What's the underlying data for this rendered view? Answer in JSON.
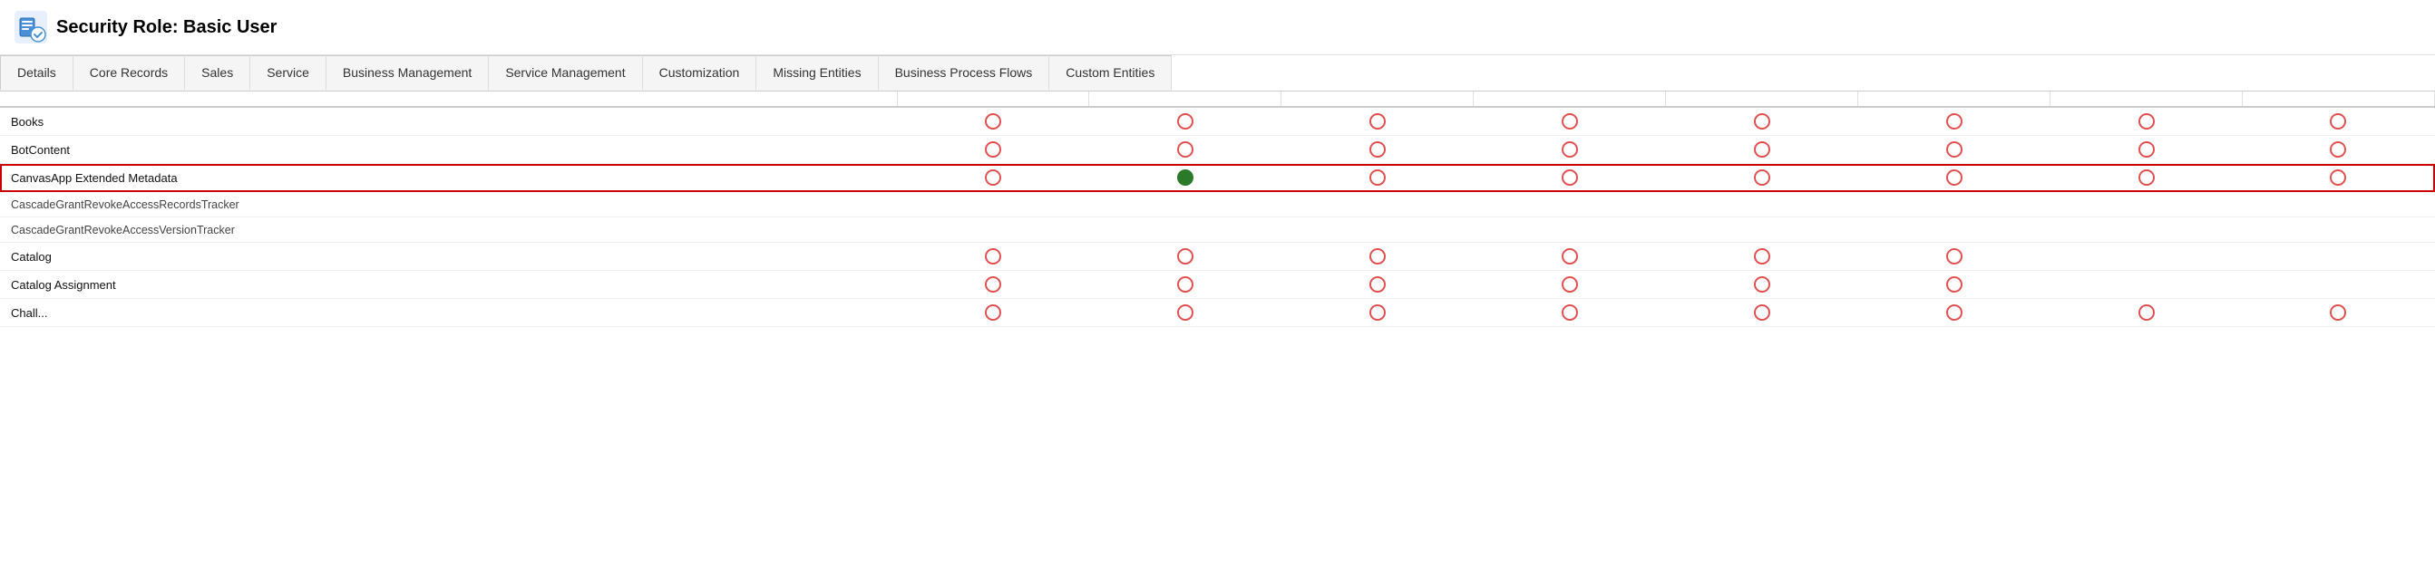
{
  "header": {
    "icon_label": "security-role-icon",
    "title": "Security Role: Basic User"
  },
  "tabs": [
    {
      "label": "Details",
      "id": "tab-details"
    },
    {
      "label": "Core Records",
      "id": "tab-core-records"
    },
    {
      "label": "Sales",
      "id": "tab-sales"
    },
    {
      "label": "Service",
      "id": "tab-service"
    },
    {
      "label": "Business Management",
      "id": "tab-business-management"
    },
    {
      "label": "Service Management",
      "id": "tab-service-management"
    },
    {
      "label": "Customization",
      "id": "tab-customization"
    },
    {
      "label": "Missing Entities",
      "id": "tab-missing-entities"
    },
    {
      "label": "Business Process Flows",
      "id": "tab-business-process-flows"
    },
    {
      "label": "Custom Entities",
      "id": "tab-custom-entities"
    }
  ],
  "table": {
    "columns": [
      {
        "label": "",
        "id": "col-entity"
      },
      {
        "label": "",
        "id": "col-1"
      },
      {
        "label": "",
        "id": "col-2"
      },
      {
        "label": "",
        "id": "col-3"
      },
      {
        "label": "",
        "id": "col-4"
      },
      {
        "label": "",
        "id": "col-5"
      },
      {
        "label": "",
        "id": "col-6"
      },
      {
        "label": "",
        "id": "col-7"
      },
      {
        "label": "",
        "id": "col-8"
      }
    ],
    "rows": [
      {
        "name": "Books",
        "highlighted": false,
        "cells": [
          "empty",
          "empty",
          "empty",
          "empty",
          "empty",
          "empty",
          "empty",
          "empty"
        ]
      },
      {
        "name": "BotContent",
        "highlighted": false,
        "cells": [
          "empty",
          "empty",
          "empty",
          "empty",
          "empty",
          "empty",
          "empty",
          "empty"
        ]
      },
      {
        "name": "CanvasApp Extended Metadata",
        "highlighted": true,
        "cells": [
          "empty",
          "filled",
          "empty",
          "empty",
          "empty",
          "empty",
          "empty",
          "empty"
        ]
      },
      {
        "name": "CascadeGrantRevokeAccessRecordsTracker",
        "highlighted": false,
        "cells": [
          "none",
          "none",
          "none",
          "none",
          "none",
          "none",
          "none",
          "none"
        ]
      },
      {
        "name": "CascadeGrantRevokeAccessVersionTracker",
        "highlighted": false,
        "cells": [
          "none",
          "none",
          "none",
          "none",
          "none",
          "none",
          "none",
          "none"
        ]
      },
      {
        "name": "Catalog",
        "highlighted": false,
        "cells": [
          "empty",
          "empty",
          "empty",
          "empty",
          "empty",
          "empty",
          "none",
          "none"
        ]
      },
      {
        "name": "Catalog Assignment",
        "highlighted": false,
        "cells": [
          "empty",
          "empty",
          "empty",
          "empty",
          "empty",
          "empty",
          "none",
          "none"
        ]
      },
      {
        "name": "Chall...",
        "highlighted": false,
        "cells": [
          "empty",
          "empty",
          "empty",
          "empty",
          "empty",
          "empty",
          "empty",
          "empty"
        ]
      }
    ]
  }
}
